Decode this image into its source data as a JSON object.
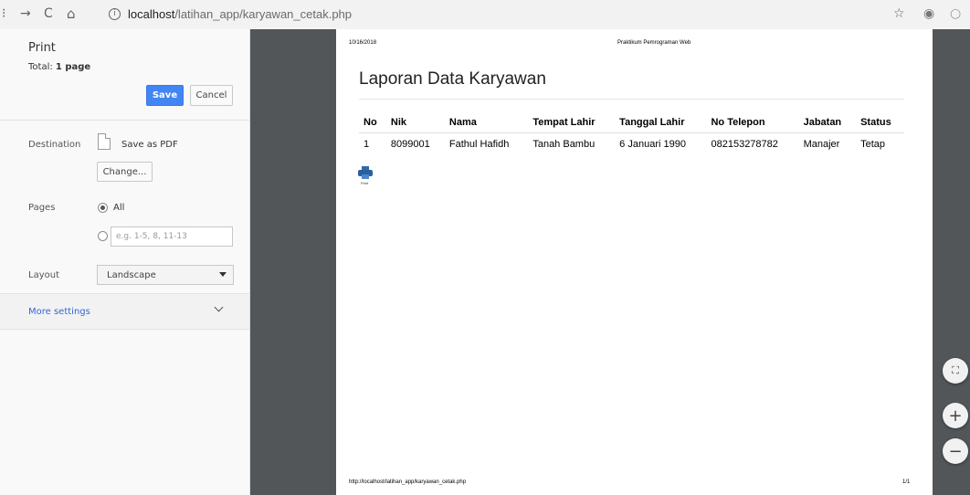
{
  "browser": {
    "url_host": "localhost",
    "url_path": "/latihan_app/karyawan_cetak.php",
    "icons": [
      "menu-icon",
      "forward-icon",
      "reload-icon",
      "home-icon",
      "info-icon",
      "star-icon",
      "extension-icon",
      "profile-icon"
    ],
    "glyphs": {
      "menu": "⁝",
      "forward": "→",
      "reload": "C",
      "home": "⌂",
      "star": "☆",
      "ext": "◉",
      "profile": "○",
      "info": "i"
    }
  },
  "sidebar": {
    "title": "Print",
    "total_label": "Total:",
    "total_value": "1 page",
    "save_label": "Save",
    "cancel_label": "Cancel",
    "destination_label": "Destination",
    "destination_value": "Save as PDF",
    "change_label": "Change...",
    "pages_label": "Pages",
    "pages_all": "All",
    "pages_placeholder": "e.g. 1-5, 8, 11-13",
    "layout_label": "Layout",
    "layout_value": "Landscape",
    "more_settings": "More settings"
  },
  "document": {
    "header_date": "10/16/2018",
    "header_title": "Praktikum Pemrograman Web",
    "report_title": "Laporan Data Karyawan",
    "columns": [
      "No",
      "Nik",
      "Nama",
      "Tempat Lahir",
      "Tanggal Lahir",
      "No Telepon",
      "Jabatan",
      "Status"
    ],
    "rows": [
      [
        "1",
        "8099001",
        "Fathul Hafidh",
        "Tanah Bambu",
        "6 Januari 1990",
        "082153278782",
        "Manajer",
        "Tetap"
      ]
    ],
    "print_label": "Print",
    "footer_url": "http://localhost/latihan_app/karyawan_cetak.php",
    "footer_page": "1/1"
  },
  "zoom": {
    "fit_glyph": "⛶",
    "plus_glyph": "+",
    "minus_glyph": "−"
  },
  "colors": {
    "accent": "#4285f4",
    "link": "#3367d6",
    "preview_bg": "#525659"
  }
}
